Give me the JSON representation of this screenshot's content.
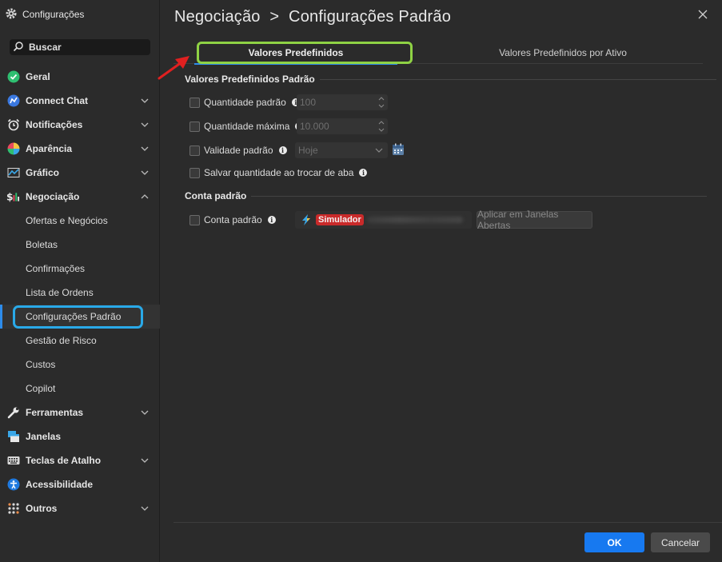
{
  "sidebar": {
    "title": "Configurações",
    "search_label": "Buscar",
    "items": [
      {
        "label": "Geral"
      },
      {
        "label": "Connect Chat"
      },
      {
        "label": "Notificações"
      },
      {
        "label": "Aparência"
      },
      {
        "label": "Gráfico"
      },
      {
        "label": "Negociação"
      },
      {
        "label": "Ofertas e Negócios"
      },
      {
        "label": "Boletas"
      },
      {
        "label": "Confirmações"
      },
      {
        "label": "Lista de Ordens"
      },
      {
        "label": "Configurações Padrão"
      },
      {
        "label": "Gestão de Risco"
      },
      {
        "label": "Custos"
      },
      {
        "label": "Copilot"
      },
      {
        "label": "Ferramentas"
      },
      {
        "label": "Janelas"
      },
      {
        "label": "Teclas de Atalho"
      },
      {
        "label": "Acessibilidade"
      },
      {
        "label": "Outros"
      }
    ]
  },
  "header": {
    "breadcrumb_parent": "Negociação",
    "breadcrumb_sep": ">",
    "breadcrumb_current": "Configurações Padrão"
  },
  "tabs": [
    {
      "label": "Valores Predefinidos"
    },
    {
      "label": "Valores Predefinidos por Ativo"
    }
  ],
  "defaults_section": {
    "title": "Valores Predefinidos Padrão",
    "quantity_label": "Quantidade padrão",
    "quantity_value": "100",
    "max_quantity_label": "Quantidade máxima",
    "max_quantity_value": "10.000",
    "validity_label": "Validade padrão",
    "validity_value": "Hoje",
    "save_on_tab_label": "Salvar quantidade ao trocar de aba"
  },
  "account_section": {
    "title": "Conta padrão",
    "account_label": "Conta padrão",
    "account_badge": "Simulador",
    "apply_label": "Aplicar em Janelas Abertas"
  },
  "footer": {
    "ok_label": "OK",
    "cancel_label": "Cancelar"
  },
  "colors": {
    "accent": "#1779f0",
    "highlight_green": "#8fd244",
    "highlight_blue": "#29a9e8",
    "annotation_arrow": "#e02020",
    "simulator_badge": "#c92a2a"
  }
}
